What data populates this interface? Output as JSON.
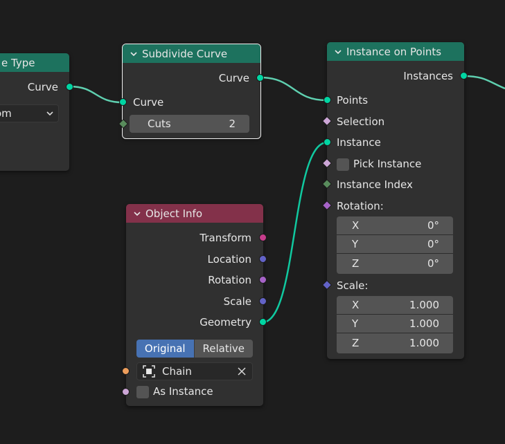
{
  "nodes": {
    "type_node": {
      "title_partial": "e Type",
      "output_curve": "Curve",
      "dropdown_value_partial": "om"
    },
    "subdivide": {
      "title": "Subdivide Curve",
      "output_curve": "Curve",
      "input_curve": "Curve",
      "cuts_label": "Cuts",
      "cuts_value": "2"
    },
    "instance_on_points": {
      "title": "Instance on Points",
      "output_instances": "Instances",
      "points": "Points",
      "selection": "Selection",
      "instance": "Instance",
      "pick_instance": "Pick Instance",
      "instance_index": "Instance Index",
      "rotation": "Rotation:",
      "rotation_xyz": [
        {
          "axis": "X",
          "value": "0°"
        },
        {
          "axis": "Y",
          "value": "0°"
        },
        {
          "axis": "Z",
          "value": "0°"
        }
      ],
      "scale": "Scale:",
      "scale_xyz": [
        {
          "axis": "X",
          "value": "1.000"
        },
        {
          "axis": "Y",
          "value": "1.000"
        },
        {
          "axis": "Z",
          "value": "1.000"
        }
      ]
    },
    "object_info": {
      "title": "Object Info",
      "transform": "Transform",
      "location": "Location",
      "rotation": "Rotation",
      "scale": "Scale",
      "geometry": "Geometry",
      "mode_original": "Original",
      "mode_relative": "Relative",
      "object_value": "Chain",
      "as_instance": "As Instance"
    }
  },
  "colors": {
    "geometry_header": "#1d725e",
    "input_header": "#83314a",
    "geometry_socket": "#00d6a3",
    "wire": "#5fd0b0",
    "toggle_active": "#4772b3"
  },
  "icons": [
    "chevron-down-icon",
    "object-icon",
    "clear-x-icon",
    "dropdown-chevron-icon"
  ]
}
